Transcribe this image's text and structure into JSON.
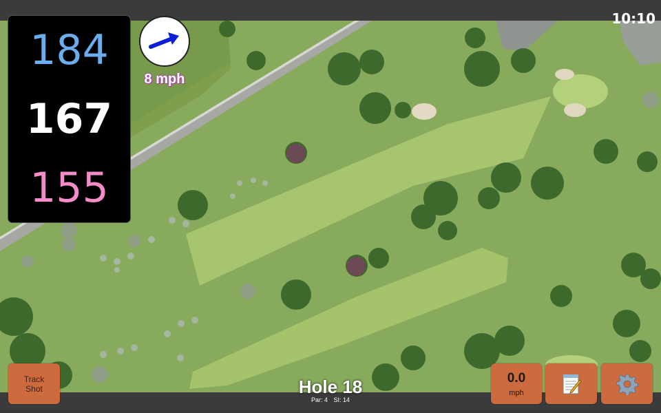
{
  "status": {
    "time": "10:10"
  },
  "distances": {
    "back": "184",
    "middle": "167",
    "front": "155"
  },
  "wind": {
    "speed_label": "8 mph",
    "direction_icon": "wind-arrow-icon",
    "arrow_color": "#0a1fd6"
  },
  "hole": {
    "title": "Hole 18",
    "par_label": "Par: 4",
    "si_label": "SI: 14"
  },
  "buttons": {
    "track_shot_line1": "Track",
    "track_shot_line2": "Shot",
    "speed_value": "0.0",
    "speed_unit": "mph",
    "notes_icon": "notepad-icon",
    "settings_icon": "gear-icon"
  },
  "colors": {
    "back_distance": "#6aaef0",
    "middle_distance": "#ffffff",
    "front_distance": "#f48cc9",
    "button_bg": "#cd6a3e"
  }
}
